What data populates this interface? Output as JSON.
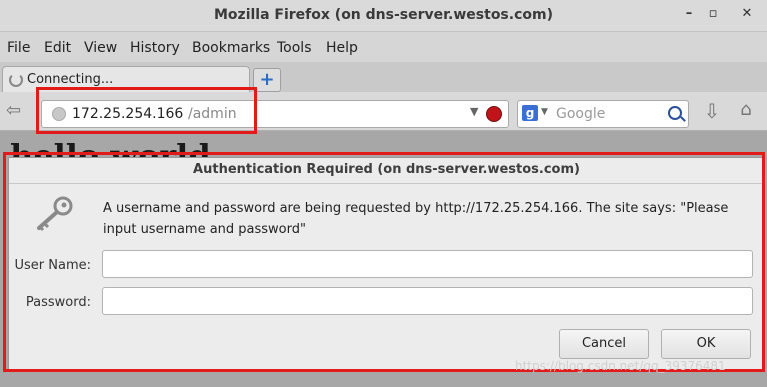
{
  "window": {
    "title": "Mozilla Firefox (on dns-server.westos.com)"
  },
  "menubar": [
    "File",
    "Edit",
    "View",
    "History",
    "Bookmarks",
    "Tools",
    "Help"
  ],
  "tab": {
    "label": "Connecting...",
    "new_tab": "+"
  },
  "navbar": {
    "url_host": "172.25.254.166",
    "url_path": "/admin",
    "search_placeholder": "Google"
  },
  "page": {
    "heading": "hello world"
  },
  "dialog": {
    "title": "Authentication Required (on dns-server.westos.com)",
    "message_line1": "A username and password are being requested by http://172.25.254.166. The site says: \"Please",
    "message_line2": "input username and password\"",
    "username_label": "User Name:",
    "password_label": "Password:",
    "username_value": "",
    "password_value": "",
    "cancel_label": "Cancel",
    "ok_label": "OK"
  },
  "watermark": "https://blog.csdn.net/qq_39376481",
  "colors": {
    "highlight": "#e21a1a",
    "stop": "#c0131a",
    "accent": "#3b6fd6"
  }
}
